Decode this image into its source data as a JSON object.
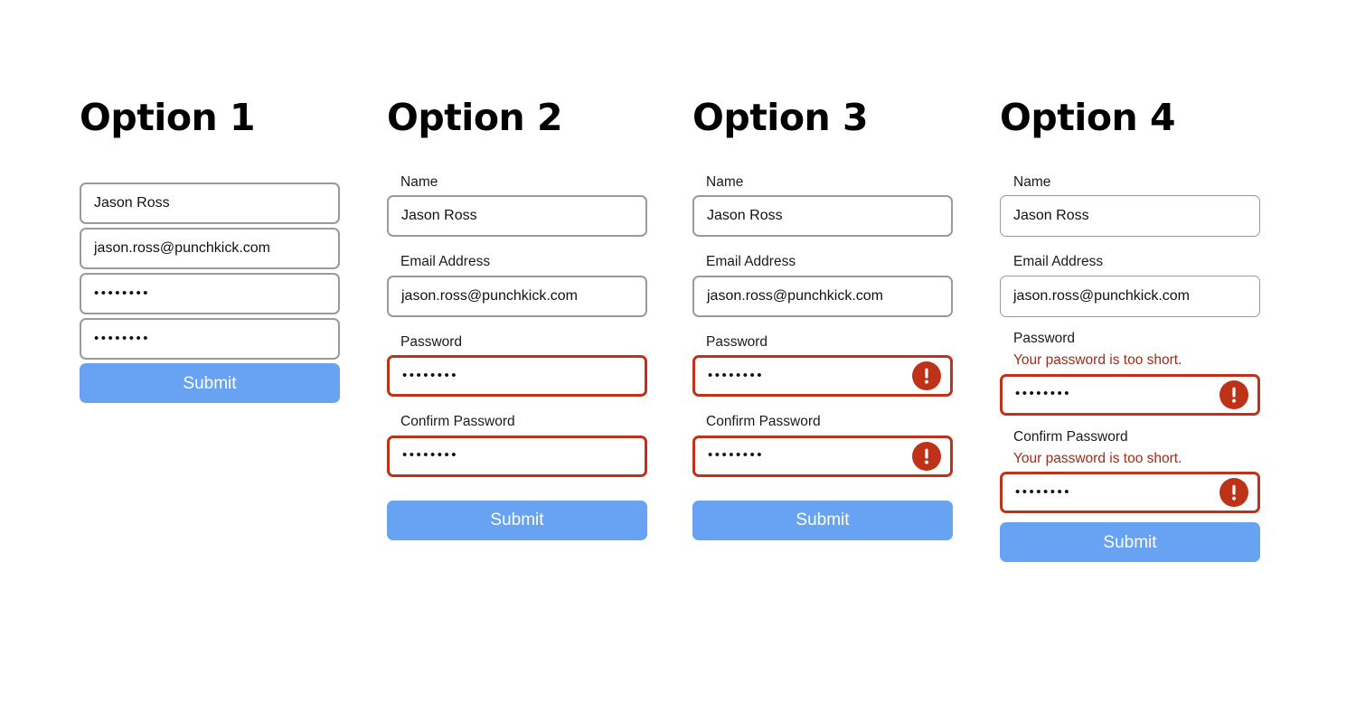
{
  "page": {
    "background": "#ffffff",
    "accent_blue": "#67A2F3",
    "error_red": "#BE3318",
    "error_text_red": "#A32B18",
    "border_gray": "#9a9a9a"
  },
  "values": {
    "name": "Jason Ross",
    "email": "jason.ross@punchkick.com",
    "password_masked": "••••••••",
    "confirm_masked": "••••••••"
  },
  "labels": {
    "name": "Name",
    "email": "Email Address",
    "password": "Password",
    "confirm_password": "Confirm Password"
  },
  "errors": {
    "password_too_short": "Your password is too short."
  },
  "icons": {
    "error": "exclamation-circle-icon"
  },
  "columns": [
    {
      "id": "option-1",
      "heading": "Option 1",
      "has_labels": false,
      "has_error_borders": false,
      "has_error_icons": false,
      "has_error_messages": false,
      "submit_label": "Submit",
      "fields": [
        {
          "key": "name",
          "label": "",
          "value": "Jason Ross",
          "type": "text",
          "state": "normal"
        },
        {
          "key": "email",
          "label": "",
          "value": "jason.ross@punchkick.com",
          "type": "email",
          "state": "normal"
        },
        {
          "key": "password",
          "label": "",
          "value": "••••••••",
          "type": "password",
          "state": "normal"
        },
        {
          "key": "confirm",
          "label": "",
          "value": "••••••••",
          "type": "password",
          "state": "normal"
        }
      ]
    },
    {
      "id": "option-2",
      "heading": "Option 2",
      "has_labels": true,
      "has_error_borders": true,
      "has_error_icons": false,
      "has_error_messages": false,
      "submit_label": "Submit",
      "fields": [
        {
          "key": "name",
          "label": "Name",
          "value": "Jason Ross",
          "type": "text",
          "state": "normal"
        },
        {
          "key": "email",
          "label": "Email Address",
          "value": "jason.ross@punchkick.com",
          "type": "email",
          "state": "normal"
        },
        {
          "key": "password",
          "label": "Password",
          "value": "••••••••",
          "type": "password",
          "state": "error"
        },
        {
          "key": "confirm",
          "label": "Confirm Password",
          "value": "••••••••",
          "type": "password",
          "state": "error"
        }
      ]
    },
    {
      "id": "option-3",
      "heading": "Option 3",
      "has_labels": true,
      "has_error_borders": true,
      "has_error_icons": true,
      "has_error_messages": false,
      "submit_label": "Submit",
      "fields": [
        {
          "key": "name",
          "label": "Name",
          "value": "Jason Ross",
          "type": "text",
          "state": "normal"
        },
        {
          "key": "email",
          "label": "Email Address",
          "value": "jason.ross@punchkick.com",
          "type": "email",
          "state": "normal"
        },
        {
          "key": "password",
          "label": "Password",
          "value": "••••••••",
          "type": "password",
          "state": "error"
        },
        {
          "key": "confirm",
          "label": "Confirm Password",
          "value": "••••••••",
          "type": "password",
          "state": "error"
        }
      ]
    },
    {
      "id": "option-4",
      "heading": "Option 4",
      "has_labels": true,
      "has_error_borders": true,
      "has_error_icons": true,
      "has_error_messages": true,
      "submit_label": "Submit",
      "fields": [
        {
          "key": "name",
          "label": "Name",
          "value": "Jason Ross",
          "type": "text",
          "state": "normal",
          "error": ""
        },
        {
          "key": "email",
          "label": "Email Address",
          "value": "jason.ross@punchkick.com",
          "type": "email",
          "state": "normal",
          "error": ""
        },
        {
          "key": "password",
          "label": "Password",
          "value": "••••••••",
          "type": "password",
          "state": "error",
          "error": "Your password is too short."
        },
        {
          "key": "confirm",
          "label": "Confirm Password",
          "value": "••••••••",
          "type": "password",
          "state": "error",
          "error": "Your password is too short."
        }
      ]
    }
  ]
}
